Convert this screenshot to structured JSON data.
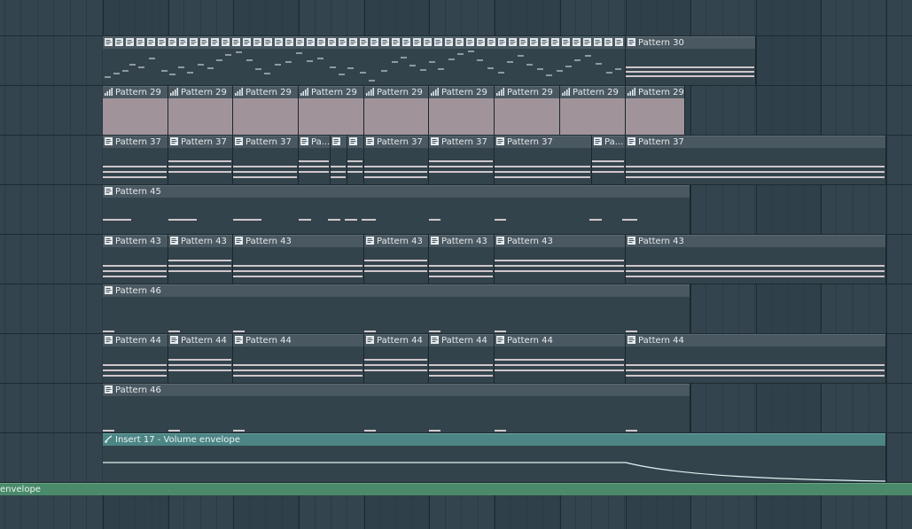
{
  "colors": {
    "background": "#34444e",
    "clip_header": "#4a5861",
    "clip_body": "#33434c",
    "pink_clip_body": "#a0949a",
    "automation_header": "#4c8584",
    "automation_line": "#dff3f1",
    "bottom_lane": "#4a8a6a",
    "note": "#cfc6cb"
  },
  "icons": {
    "pattern": "pattern-icon",
    "audio_pattern": "audio-pattern-icon",
    "automation": "automation-icon"
  },
  "playlist": {
    "rows": [
      {
        "clips": [
          {
            "label": "",
            "kind": "mini"
          },
          {
            "label": "Pattern 30"
          }
        ]
      },
      {
        "clips": [
          {
            "label": "Pattern 29"
          },
          {
            "label": "Pattern 29"
          },
          {
            "label": "Pattern 29"
          },
          {
            "label": "Pattern 29"
          },
          {
            "label": "Pattern 29"
          },
          {
            "label": "Pattern 29"
          },
          {
            "label": "Pattern 29"
          },
          {
            "label": "Pattern 29"
          },
          {
            "label": "Pattern 29"
          }
        ]
      },
      {
        "clips": [
          {
            "label": "Pattern 37"
          },
          {
            "label": "Pattern 37"
          },
          {
            "label": "Pattern 37"
          },
          {
            "label": "Pa..."
          },
          {
            "label": ""
          },
          {
            "label": ""
          },
          {
            "label": "Pattern 37"
          },
          {
            "label": "Pattern 37"
          },
          {
            "label": "Pattern 37"
          },
          {
            "label": "Pa..."
          },
          {
            "label": "Pattern 37"
          }
        ]
      },
      {
        "clips": [
          {
            "label": "Pattern 45"
          }
        ]
      },
      {
        "clips": [
          {
            "label": "Pattern 43"
          },
          {
            "label": "Pattern 43"
          },
          {
            "label": "Pattern 43"
          },
          {
            "label": "Pattern 43"
          },
          {
            "label": "Pattern 43"
          },
          {
            "label": "Pattern 43"
          },
          {
            "label": "Pattern 43"
          }
        ]
      },
      {
        "clips": [
          {
            "label": "Pattern 46"
          }
        ]
      },
      {
        "clips": [
          {
            "label": "Pattern 44"
          },
          {
            "label": "Pattern 44"
          },
          {
            "label": "Pattern 44"
          },
          {
            "label": "Pattern 44"
          },
          {
            "label": "Pattern 44"
          },
          {
            "label": "Pattern 44"
          },
          {
            "label": "Pattern 44"
          }
        ]
      },
      {
        "clips": [
          {
            "label": "Pattern 46"
          }
        ]
      },
      {
        "clips": [
          {
            "label": "Insert 17 - Volume envelope"
          }
        ]
      }
    ],
    "bottom_lane": {
      "label": "envelope"
    }
  }
}
